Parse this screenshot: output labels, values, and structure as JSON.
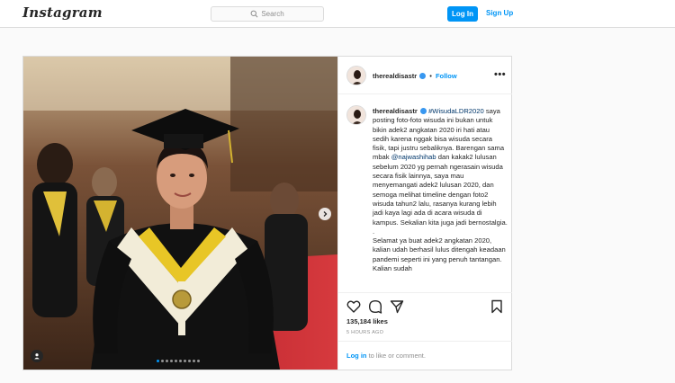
{
  "header": {
    "logo": "Instagram",
    "search_placeholder": "Search",
    "login_label": "Log In",
    "signup_label": "Sign Up"
  },
  "post": {
    "username": "therealdisastr",
    "follow_label": "Follow",
    "separator": "•",
    "more_label": "•••",
    "caption": {
      "hashtag": "#WisudaLDR2020",
      "text_1": "saya posting foto-foto wisuda ini bukan untuk bikin adek2 angkatan 2020 iri hati atau sedih karena nggak bisa wisuda secara fisik, tapi justru sebaliknya. Barengan sama mbak",
      "mention": "@najwashihab",
      "text_2": "dan kakak2 lulusan sebelum 2020 yg pernah ngerasain wisuda secara fisik lainnya, saya mau menyemangati adek2 lulusan 2020, dan semoga melihat timeline dengan foto2 wisuda tahun2 lalu, rasanya kurang lebih jadi kaya lagi ada di acara wisuda di kampus. Sekalian kita juga jadi bernostalgia.\n.\nSelamat ya buat adek2 angkatan 2020, kalian udah berhasil lulus ditengah keadaan pandemi seperti ini yang penuh tantangan. Kalian sudah"
    },
    "likes": "135,184 likes",
    "time": "5 HOURS AGO",
    "comment_link": "Log in",
    "comment_text": "to like or comment.",
    "carousel_count": 10,
    "carousel_active": 1
  },
  "colors": {
    "accent": "#0095f6",
    "verified": "#3897f0",
    "border": "#dbdbdb"
  }
}
